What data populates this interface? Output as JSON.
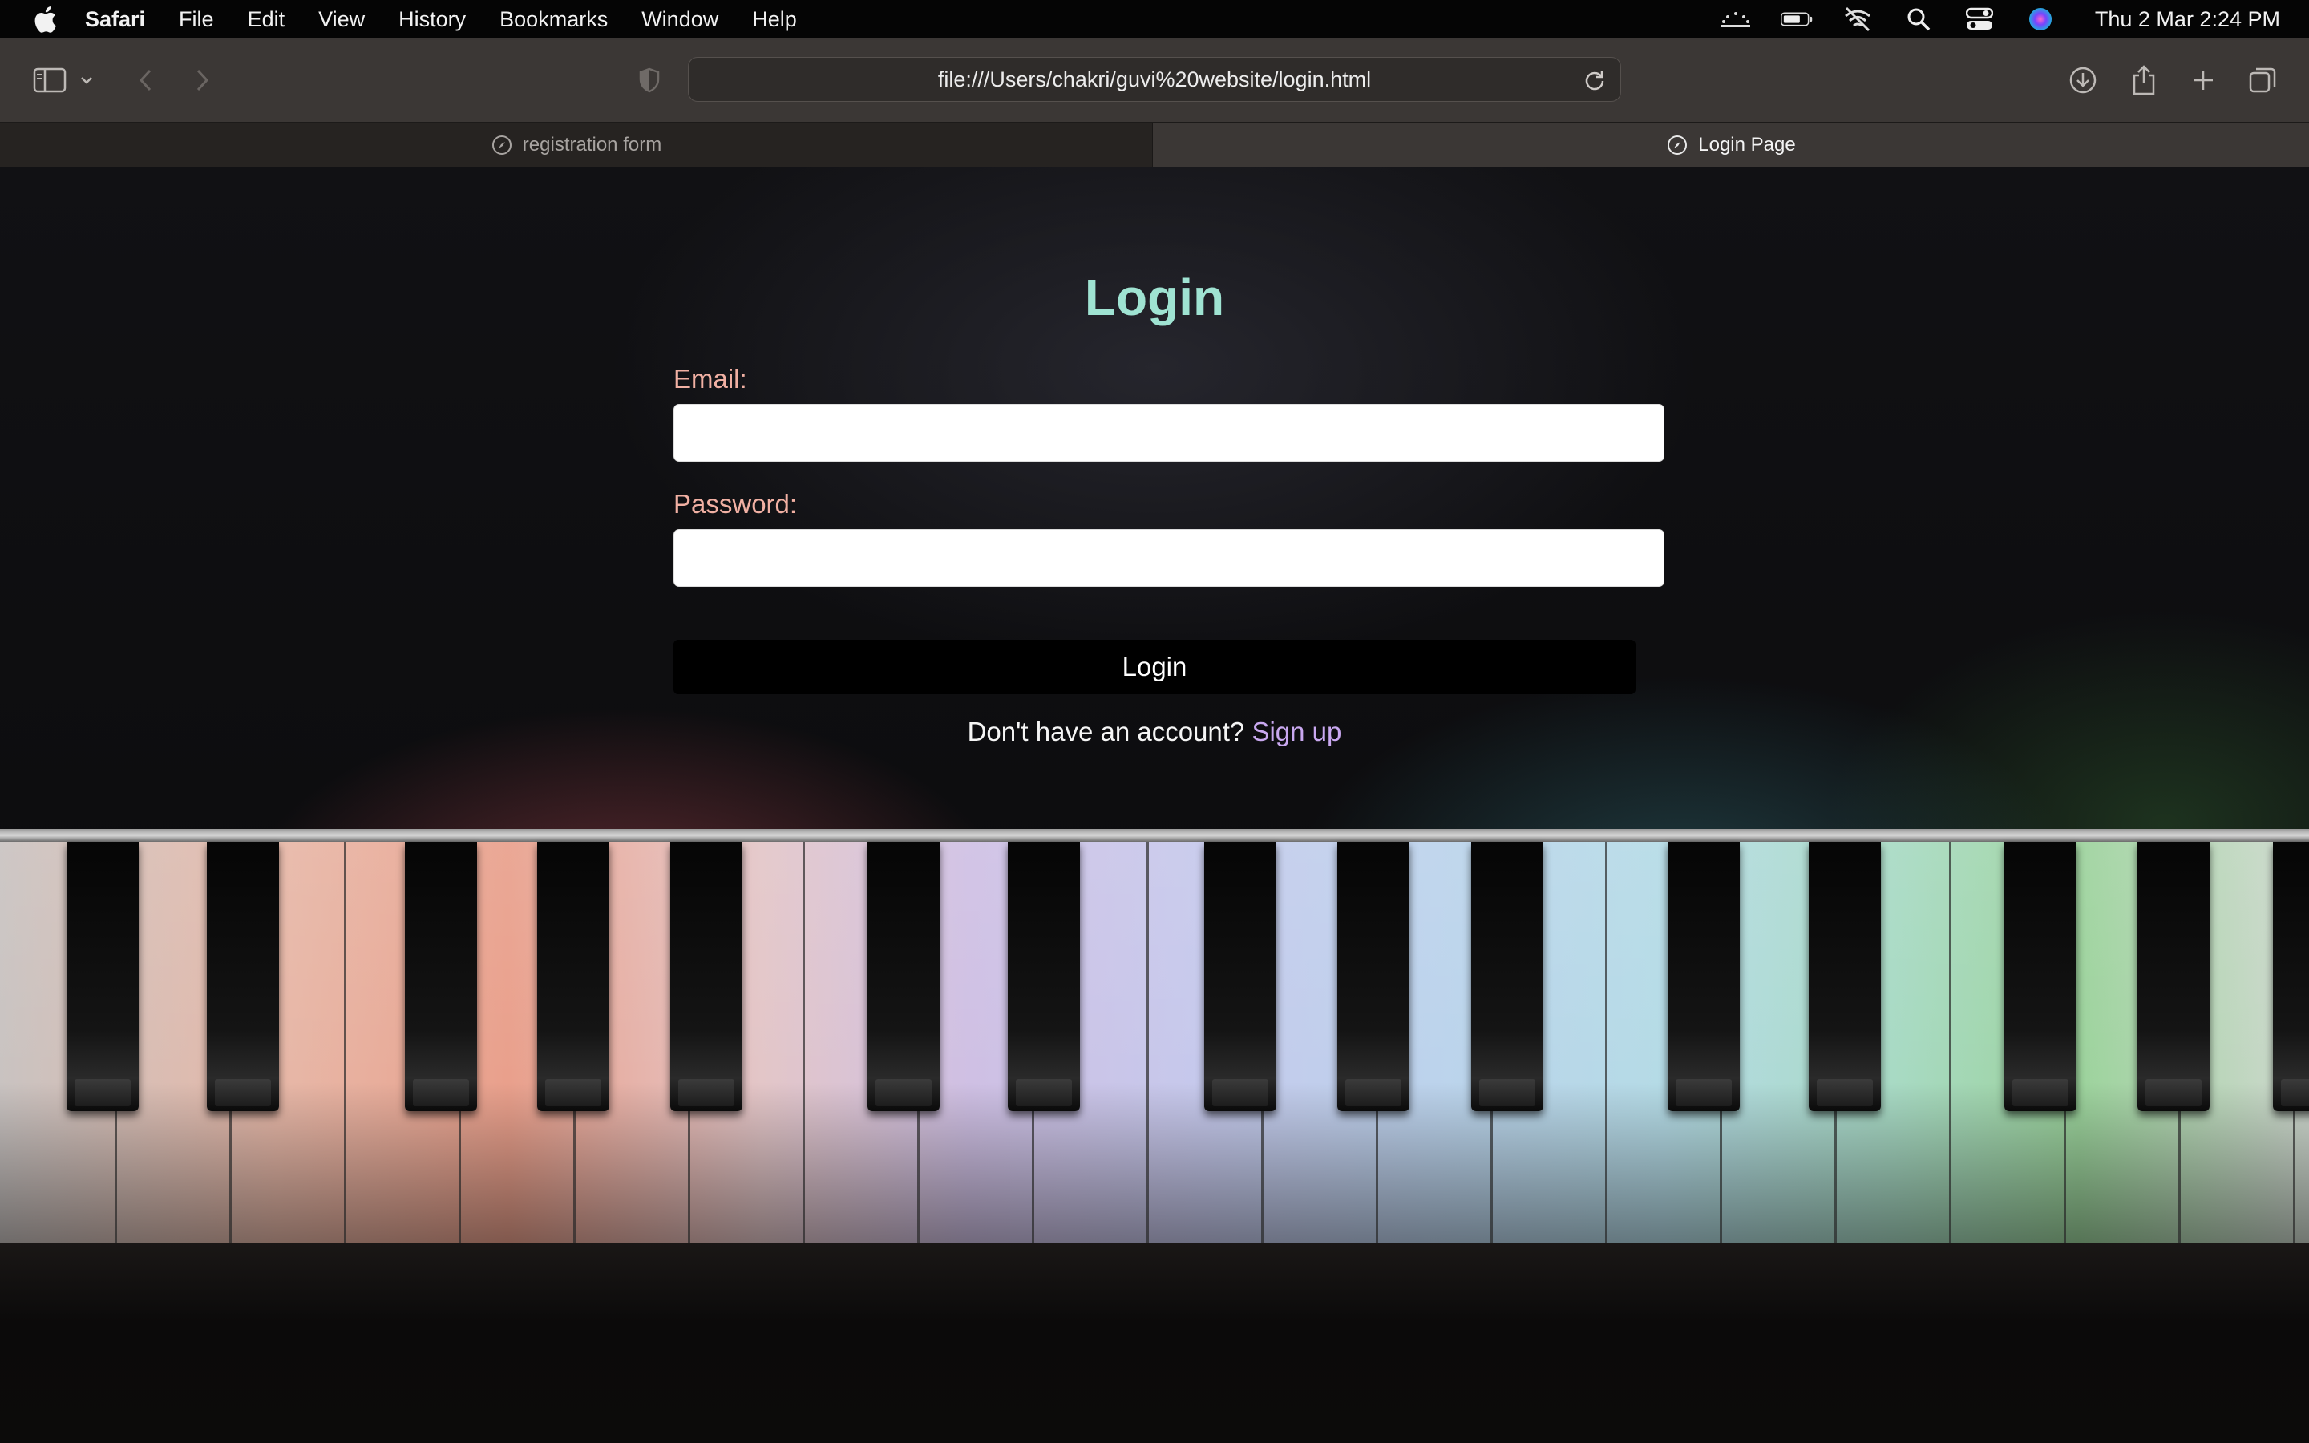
{
  "menubar": {
    "app_name": "Safari",
    "items": [
      "File",
      "Edit",
      "View",
      "History",
      "Bookmarks",
      "Window",
      "Help"
    ],
    "clock": "Thu 2 Mar  2:24 PM"
  },
  "toolbar": {
    "url": "file:///Users/chakri/guvi%20website/login.html"
  },
  "tabs": [
    {
      "label": "registration form",
      "active": false
    },
    {
      "label": "Login Page",
      "active": true
    }
  ],
  "page": {
    "title": "Login",
    "email_label": "Email:",
    "password_label": "Password:",
    "email_value": "",
    "password_value": "",
    "login_button": "Login",
    "signup_prompt": "Don't have an account?",
    "signup_link": "Sign up"
  },
  "colors": {
    "title": "#9fe3d2",
    "label": "#f1b0a3",
    "link": "#c9a8f0"
  },
  "icons": [
    "apple-icon",
    "sidebar-icon",
    "chevron-down-icon",
    "back-icon",
    "forward-icon",
    "privacy-shield-icon",
    "reload-icon",
    "download-icon",
    "share-icon",
    "new-tab-icon",
    "tab-overview-icon",
    "compass-icon",
    "keyboard-brightness-icon",
    "battery-icon",
    "wifi-off-icon",
    "search-icon",
    "control-center-icon",
    "siri-icon"
  ]
}
